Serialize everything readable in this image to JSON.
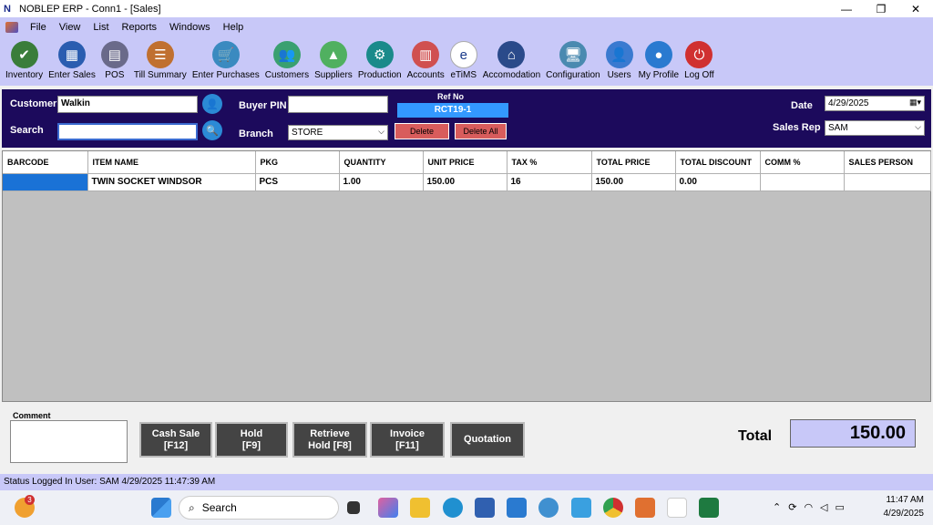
{
  "window": {
    "title": "NOBLEP ERP - Conn1 - [Sales]",
    "minimize": "—",
    "restore": "❐",
    "close": "✕"
  },
  "menu": [
    "File",
    "View",
    "List",
    "Reports",
    "Windows",
    "Help"
  ],
  "mdi": {
    "minimize": "_",
    "restore": "❐",
    "close": "✕"
  },
  "toolbar": [
    {
      "label": "Inventory",
      "icon": "inventory-icon",
      "color": "#3a7d3a",
      "glyph": "✔"
    },
    {
      "label": "Enter Sales",
      "icon": "calculator-icon",
      "color": "#2a5db0",
      "glyph": "▦"
    },
    {
      "label": "POS",
      "icon": "pos-icon",
      "color": "#6a6a8a",
      "glyph": "▤"
    },
    {
      "label": "Till Summary",
      "icon": "till-summary-icon",
      "color": "#c07030",
      "glyph": "☰"
    },
    {
      "label": "Enter Purchases",
      "icon": "cart-icon",
      "color": "#3a8ac0",
      "glyph": "🛒"
    },
    {
      "label": "Customers",
      "icon": "customers-icon",
      "color": "#3aa070",
      "glyph": "👥"
    },
    {
      "label": "Suppliers",
      "icon": "suppliers-icon",
      "color": "#50b060",
      "glyph": "▲"
    },
    {
      "label": "Production",
      "icon": "production-icon",
      "color": "#1a8a8a",
      "glyph": "⚙"
    },
    {
      "label": "Accounts",
      "icon": "accounts-icon",
      "color": "#d05050",
      "glyph": "▥"
    },
    {
      "label": "eTiMS",
      "icon": "etims-icon",
      "color": "#ffffff",
      "glyph": "e"
    },
    {
      "label": "Accomodation",
      "icon": "accomodation-icon",
      "color": "#2a4a8a",
      "glyph": "⌂"
    },
    {
      "label": "Configuration",
      "icon": "configuration-icon",
      "color": "#4a8ab0",
      "glyph": "🖥"
    },
    {
      "label": "Users",
      "icon": "users-icon",
      "color": "#3a7ad0",
      "glyph": "👤"
    },
    {
      "label": "My Profile",
      "icon": "profile-icon",
      "color": "#2a7ad0",
      "glyph": "●"
    },
    {
      "label": "Log Off",
      "icon": "logoff-icon",
      "color": "#d03030",
      "glyph": "⏻"
    }
  ],
  "header": {
    "customer_label": "Customer",
    "customer_value": "Walkin",
    "search_label": "Search",
    "search_value": "",
    "buyer_pin_label": "Buyer PIN",
    "buyer_pin_value": "",
    "branch_label": "Branch",
    "branch_value": "STORE",
    "ref_label": "Ref No",
    "ref_value": "RCT19-1",
    "delete_label": "Delete",
    "delete_all_label": "Delete All",
    "date_label": "Date",
    "date_value": "4/29/2025",
    "sales_rep_label": "Sales Rep",
    "sales_rep_value": "SAM"
  },
  "grid": {
    "columns": [
      "BARCODE",
      "ITEM NAME",
      "PKG",
      "QUANTITY",
      "UNIT PRICE",
      "TAX %",
      "TOTAL PRICE",
      "TOTAL DISCOUNT",
      "COMM %",
      "SALES PERSON"
    ],
    "rows": [
      [
        "",
        "TWIN SOCKET WINDSOR",
        "PCS",
        "1.00",
        "150.00",
        "16",
        "150.00",
        "0.00",
        "",
        ""
      ]
    ]
  },
  "bottom": {
    "comment_label": "Comment",
    "buttons": [
      {
        "line1": "Cash Sale",
        "line2": "[F12]"
      },
      {
        "line1": "Hold",
        "line2": "[F9]"
      },
      {
        "line1": "Retrieve",
        "line2": "Hold [F8]"
      },
      {
        "line1": "Invoice",
        "line2": "[F11]"
      },
      {
        "line1": "Quotation",
        "line2": ""
      }
    ],
    "total_label": "Total",
    "total_value": "150.00"
  },
  "status": "Status  Logged In User: SAM  4/29/2025 11:47:39 AM",
  "taskbar": {
    "search_placeholder": "Search",
    "notification_badge": "3",
    "time": "11:47 AM",
    "date": "4/29/2025"
  }
}
